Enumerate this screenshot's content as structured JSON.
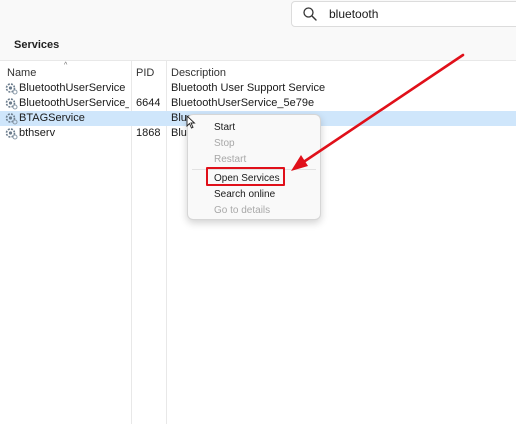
{
  "search": {
    "value": "bluetooth"
  },
  "panel": {
    "title": "Services"
  },
  "columns": [
    "Name",
    "PID",
    "Description"
  ],
  "rows": [
    {
      "name": "BluetoothUserService",
      "pid": "",
      "description": "Bluetooth User Support Service"
    },
    {
      "name": "BluetoothUserService_5e...",
      "pid": "6644",
      "description": "BluetoothUserService_5e79e"
    },
    {
      "name": "BTAGService",
      "pid": "",
      "description": "Blue"
    },
    {
      "name": "bthserv",
      "pid": "1868",
      "description": "Blue"
    }
  ],
  "selected_row": "BTAGService",
  "context_menu": {
    "items": [
      {
        "label": "Start",
        "enabled": true
      },
      {
        "label": "Stop",
        "enabled": false
      },
      {
        "label": "Restart",
        "enabled": false
      },
      {
        "label": "Open Services",
        "enabled": true
      },
      {
        "label": "Search online",
        "enabled": true
      },
      {
        "label": "Go to details",
        "enabled": false
      }
    ]
  },
  "annotation": {
    "color": "#e0101a",
    "target": "Open Services"
  },
  "icons": {
    "search": "search-icon",
    "service": "service-gear-icon",
    "sort": "sort-up-icon",
    "cursor": "mouse-cursor-icon"
  }
}
